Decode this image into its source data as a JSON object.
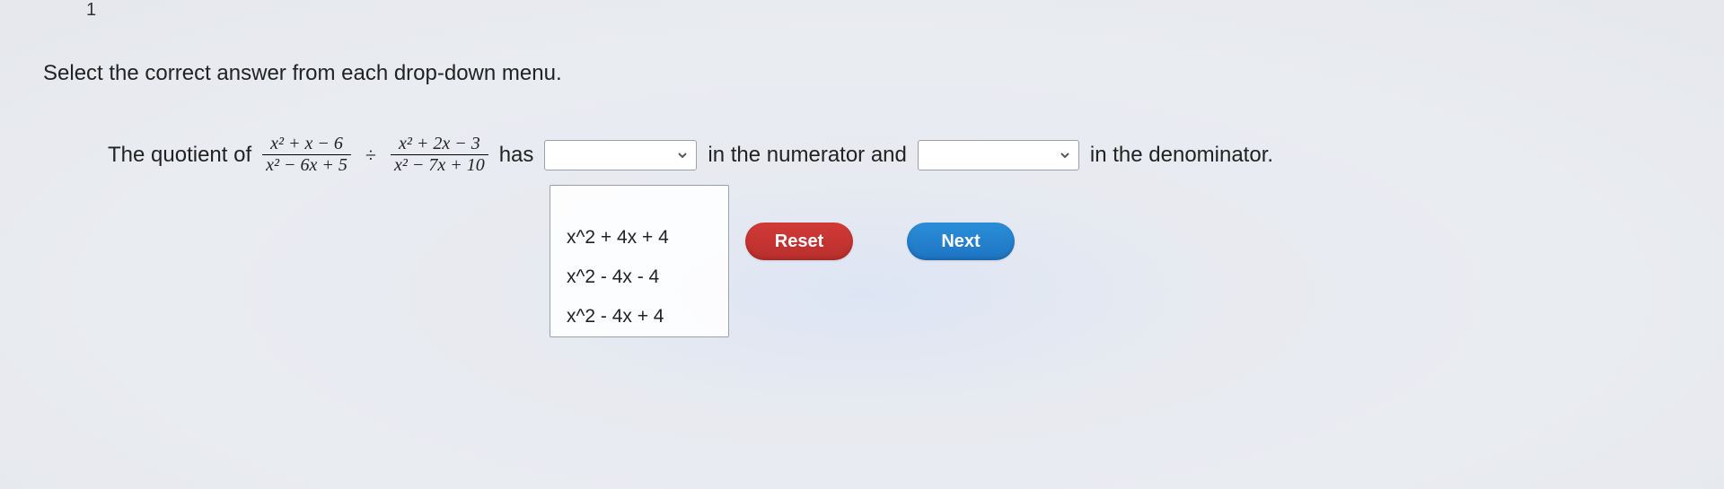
{
  "question_number": "1",
  "instruction": "Select the correct answer from each drop-down menu.",
  "sentence": {
    "lead": "The quotient of",
    "frac1_num": "x² + x − 6",
    "frac1_den": "x² − 6x + 5",
    "div_symbol": "÷",
    "frac2_num": "x² + 2x − 3",
    "frac2_den": "x² − 7x + 10",
    "has": "has",
    "mid": "in the numerator and",
    "tail": "in the denominator."
  },
  "dropdown1": {
    "selected": "",
    "options": [
      "x^2 + 4x + 4",
      "x^2 - 4x - 4",
      "x^2 - 4x + 4"
    ]
  },
  "dropdown2": {
    "selected": ""
  },
  "buttons": {
    "reset": "Reset",
    "next": "Next"
  }
}
